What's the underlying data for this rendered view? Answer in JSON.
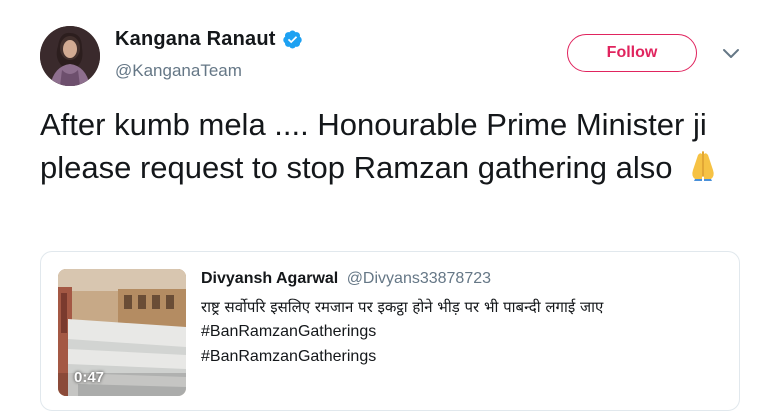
{
  "author": {
    "display_name": "Kangana Ranaut",
    "handle": "@KanganaTeam",
    "verified": true
  },
  "actions": {
    "follow_label": "Follow"
  },
  "tweet": {
    "text": "After kumb mela .... Honourable Prime Minister ji please request to stop Ramzan gathering also",
    "emoji": "folded-hands"
  },
  "quoted_tweet": {
    "display_name": "Divyansh Agarwal",
    "handle": "@Divyans33878723",
    "lines": [
      "राष्ट्र सर्वोपरि इसलिए रमजान पर इकट्ठा होने भीड़ पर भी पाबन्दी लगाई जाए",
      "#BanRamzanGatherings",
      "#BanRamzanGatherings"
    ],
    "media": {
      "type": "video",
      "duration": "0:47"
    }
  },
  "colors": {
    "follow_accent": "#e0245e",
    "verified_blue": "#1da1f2",
    "secondary_text": "#657786",
    "border": "#e1e8ed"
  }
}
